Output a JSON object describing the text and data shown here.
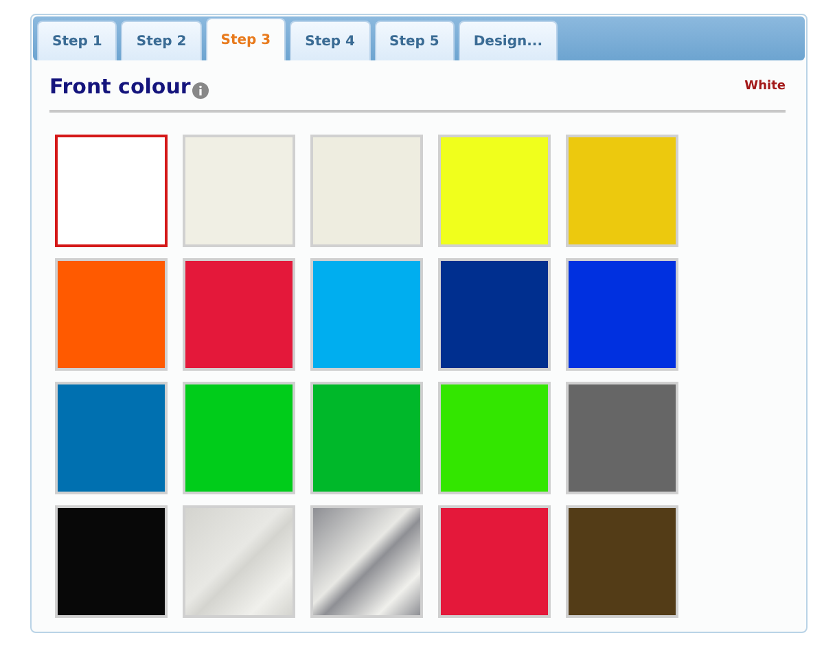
{
  "tabs": [
    {
      "label": "Step 1",
      "selected": false
    },
    {
      "label": "Step 2",
      "selected": false
    },
    {
      "label": "Step 3",
      "selected": true
    },
    {
      "label": "Step 4",
      "selected": false
    },
    {
      "label": "Step 5",
      "selected": false
    },
    {
      "label": "Design...",
      "selected": false
    }
  ],
  "section": {
    "title": "Front colour",
    "chosen": "White"
  },
  "swatches": [
    {
      "kind": "solid",
      "color": "#ffffff",
      "selected": true
    },
    {
      "kind": "solid",
      "color": "#f0efe4",
      "selected": false
    },
    {
      "kind": "solid",
      "color": "#eeede0",
      "selected": false
    },
    {
      "kind": "solid",
      "color": "#f0ff1c",
      "selected": false
    },
    {
      "kind": "solid",
      "color": "#ecc90e",
      "selected": false
    },
    {
      "kind": "solid",
      "color": "#ff5a00",
      "selected": false
    },
    {
      "kind": "solid",
      "color": "#e4183a",
      "selected": false
    },
    {
      "kind": "solid",
      "color": "#00aeef",
      "selected": false
    },
    {
      "kind": "solid",
      "color": "#002f8f",
      "selected": false
    },
    {
      "kind": "solid",
      "color": "#0030e0",
      "selected": false
    },
    {
      "kind": "solid",
      "color": "#0070b0",
      "selected": false
    },
    {
      "kind": "solid",
      "color": "#00cc1a",
      "selected": false
    },
    {
      "kind": "solid",
      "color": "#00b82a",
      "selected": false
    },
    {
      "kind": "solid",
      "color": "#33e600",
      "selected": false
    },
    {
      "kind": "solid",
      "color": "#666666",
      "selected": false
    },
    {
      "kind": "solid",
      "color": "#080808",
      "selected": false
    },
    {
      "kind": "metallic",
      "color": "#d4d4cf",
      "selected": false
    },
    {
      "kind": "metallic",
      "color": "#8e8f94",
      "selected": false
    },
    {
      "kind": "solid",
      "color": "#e4183a",
      "selected": false
    },
    {
      "kind": "solid",
      "color": "#533c17",
      "selected": false
    }
  ]
}
